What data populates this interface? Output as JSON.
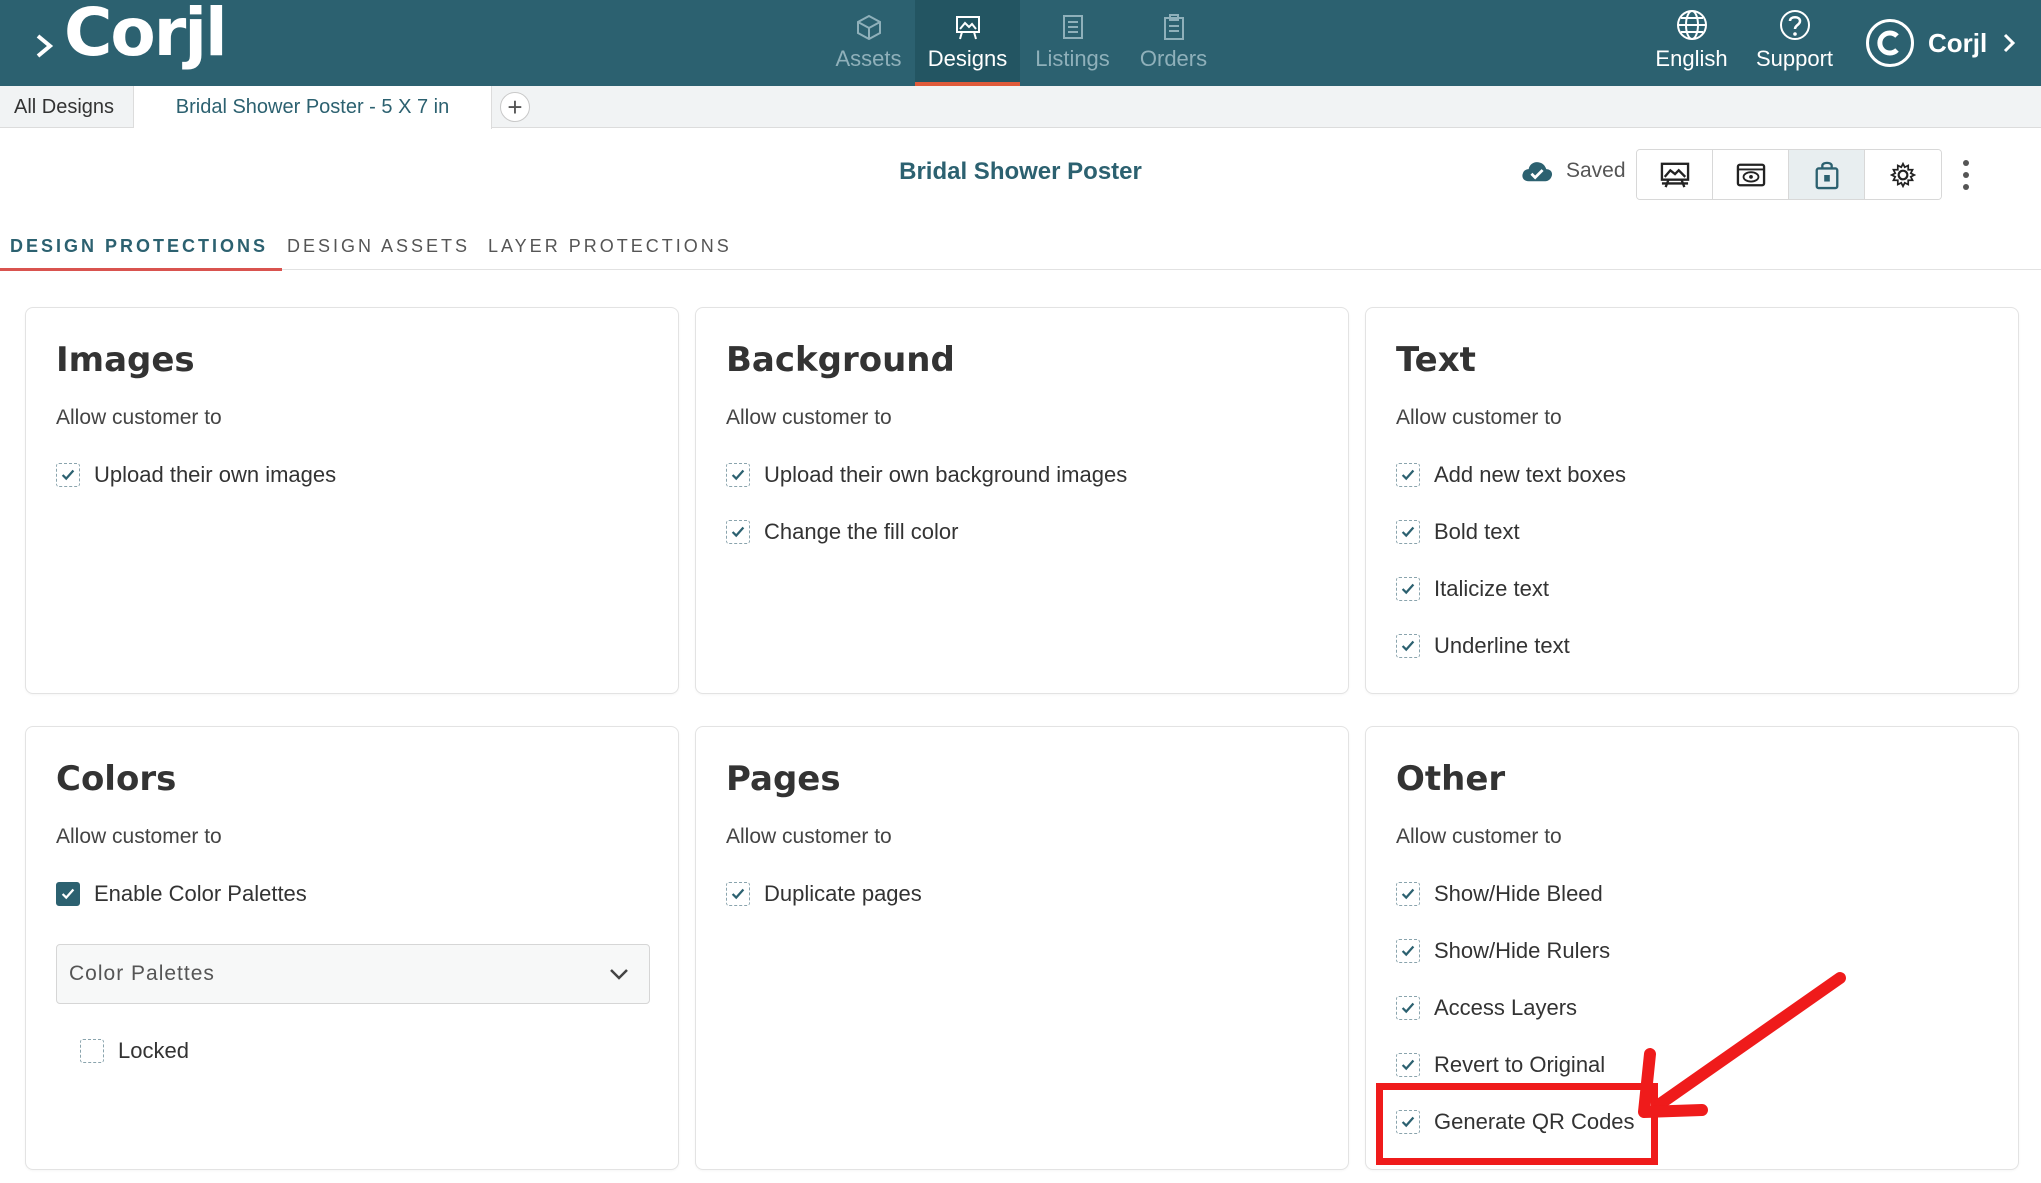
{
  "topbar": {
    "logo": "Corjl",
    "nav": [
      {
        "label": "Assets",
        "active": false
      },
      {
        "label": "Designs",
        "active": true
      },
      {
        "label": "Listings",
        "active": false
      },
      {
        "label": "Orders",
        "active": false
      }
    ],
    "language_label": "English",
    "support_label": "Support",
    "account_label": "Corjl"
  },
  "doc_tabs": {
    "all_designs": "All Designs",
    "current": "Bridal Shower Poster - 5 X 7 in",
    "add": "+"
  },
  "header": {
    "title": "Bridal Shower Poster",
    "saved_label": "Saved"
  },
  "section_tabs": [
    "DESIGN PROTECTIONS",
    "DESIGN ASSETS",
    "LAYER PROTECTIONS"
  ],
  "cards": {
    "images": {
      "title": "Images",
      "subtitle": "Allow customer to",
      "options": [
        {
          "label": "Upload their own images",
          "checked": true
        }
      ]
    },
    "background": {
      "title": "Background",
      "subtitle": "Allow customer to",
      "options": [
        {
          "label": "Upload their own background images",
          "checked": true
        },
        {
          "label": "Change the fill color",
          "checked": true
        }
      ]
    },
    "text": {
      "title": "Text",
      "subtitle": "Allow customer to",
      "options": [
        {
          "label": "Add new text boxes",
          "checked": true
        },
        {
          "label": "Bold text",
          "checked": true
        },
        {
          "label": "Italicize text",
          "checked": true
        },
        {
          "label": "Underline text",
          "checked": true
        }
      ]
    },
    "colors": {
      "title": "Colors",
      "subtitle": "Allow customer to",
      "options": [
        {
          "label": "Enable Color Palettes",
          "checked": true
        }
      ],
      "select_placeholder": "Color Palettes",
      "locked_label": "Locked",
      "locked_checked": false
    },
    "pages": {
      "title": "Pages",
      "subtitle": "Allow customer to",
      "options": [
        {
          "label": "Duplicate pages",
          "checked": true
        }
      ]
    },
    "other": {
      "title": "Other",
      "subtitle": "Allow customer to",
      "options": [
        {
          "label": "Show/Hide Bleed",
          "checked": true
        },
        {
          "label": "Show/Hide Rulers",
          "checked": true
        },
        {
          "label": "Access Layers",
          "checked": true
        },
        {
          "label": "Revert to Original",
          "checked": true
        },
        {
          "label": "Generate QR Codes",
          "checked": true
        }
      ]
    }
  },
  "colors": {
    "brand": "#2c6170",
    "accent": "#e05a3a",
    "annotation": "#ef1b1b"
  }
}
